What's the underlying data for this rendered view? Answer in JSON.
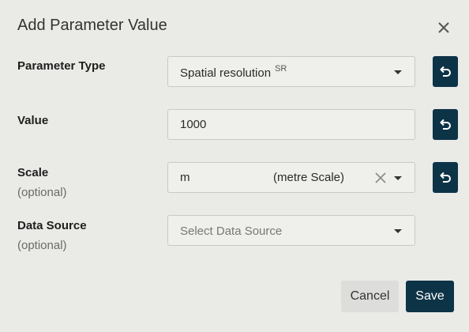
{
  "dialog": {
    "title": "Add Parameter Value",
    "close_icon": "close-icon"
  },
  "fields": {
    "parameter_type": {
      "label": "Parameter Type",
      "value": "Spatial resolution",
      "abbreviation": "SR"
    },
    "value": {
      "label": "Value",
      "value": "1000"
    },
    "scale": {
      "label": "Scale",
      "optional": "(optional)",
      "value": "m",
      "description": "(metre Scale)"
    },
    "data_source": {
      "label": "Data Source",
      "optional": "(optional)",
      "placeholder": "Select Data Source"
    }
  },
  "buttons": {
    "cancel": "Cancel",
    "save": "Save"
  },
  "colors": {
    "accent": "#0d3347",
    "background": "#eaeae7"
  }
}
